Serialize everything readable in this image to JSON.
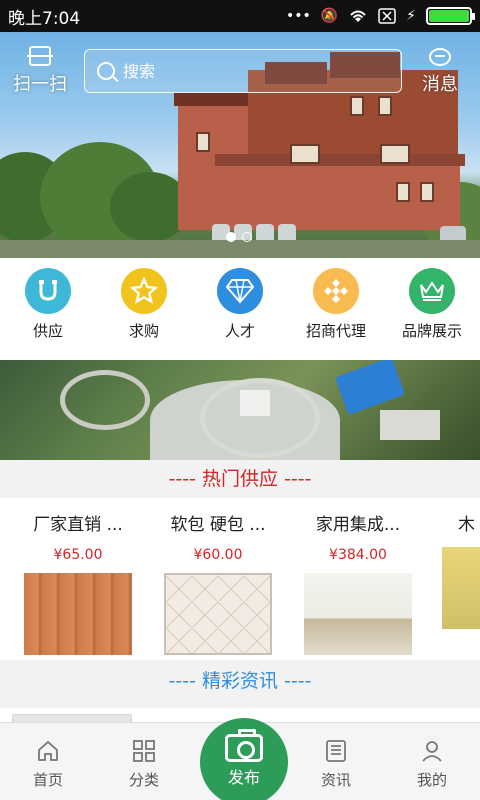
{
  "status_bar": {
    "time": "晚上7:04"
  },
  "header": {
    "scan_label": "扫一扫",
    "search_placeholder": "搜索",
    "message_label": "消息"
  },
  "categories": [
    {
      "label": "供应",
      "icon": "u-magnet-icon",
      "color": "#3fb7d9"
    },
    {
      "label": "求购",
      "icon": "star-icon",
      "color": "#f1c31d"
    },
    {
      "label": "人才",
      "icon": "diamond-icon",
      "color": "#2e8fe0"
    },
    {
      "label": "招商代理",
      "icon": "diamond-pattern-icon",
      "color": "#f7bb4f"
    },
    {
      "label": "品牌展示",
      "icon": "crown-icon",
      "color": "#34b36b"
    }
  ],
  "hot_supply": {
    "title": "----  热门供应  ----",
    "items": [
      {
        "name": "厂家直销 ...",
        "price": "¥65.00"
      },
      {
        "name": "软包 硬包 ...",
        "price": "¥60.00"
      },
      {
        "name": "家用集成...",
        "price": "¥384.00"
      },
      {
        "name": "木",
        "price": ""
      }
    ]
  },
  "news": {
    "title": "----  精彩资讯  ----"
  },
  "bottom_nav": {
    "home": "首页",
    "category": "分类",
    "publish": "发布",
    "news": "资讯",
    "mine": "我的"
  },
  "colors": {
    "accent_green": "#2e9c59",
    "price_red": "#d52424",
    "hot_title_red": "#d52424",
    "news_title_blue": "#2e8fe0"
  }
}
